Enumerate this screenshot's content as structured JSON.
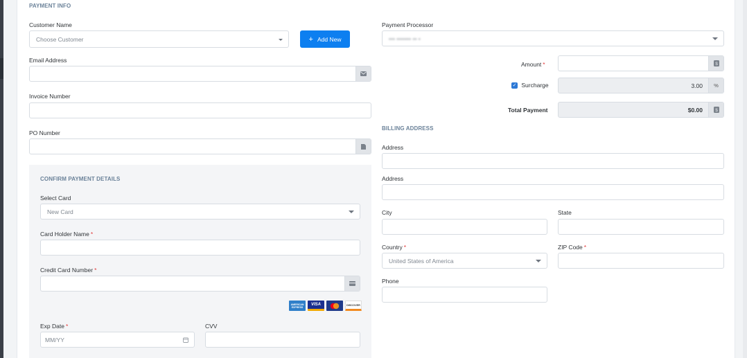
{
  "payment_info": {
    "title": "PAYMENT INFO",
    "customer_name_label": "Customer Name",
    "customer_placeholder": "Choose Customer",
    "add_new_label": "Add New",
    "email_label": "Email Address",
    "invoice_label": "Invoice Number",
    "po_label": "PO Number"
  },
  "processor": {
    "label": "Payment Processor",
    "value": "••• ••••••• •• •"
  },
  "amounts": {
    "amount_label": "Amount",
    "surcharge_label": "Surcharge",
    "surcharge_value": "3.00",
    "surcharge_unit": "%",
    "total_label": "Total Payment",
    "total_value": "$0.00",
    "required_mark": "*"
  },
  "billing": {
    "title": "BILLING ADDRESS",
    "address1_label": "Address",
    "address2_label": "Address",
    "city_label": "City",
    "state_label": "State",
    "country_label": "Country",
    "country_value": "United States of America",
    "zip_label": "ZIP Code",
    "phone_label": "Phone"
  },
  "confirm": {
    "title": "CONFIRM PAYMENT DETAILS",
    "select_card_label": "Select Card",
    "select_card_value": "New Card",
    "holder_label": "Card Holder Name",
    "ccnum_label": "Credit Card Number",
    "exp_label": "Exp Date",
    "exp_placeholder": "MM/YY",
    "cvv_label": "CVV",
    "card_brands": [
      "AMERICAN EXPRESS",
      "VISA",
      "MC",
      "DISCOVER"
    ]
  },
  "colors": {
    "accent": "#0d7ff0",
    "section_title": "#6b8299",
    "required": "#e23b3b"
  }
}
